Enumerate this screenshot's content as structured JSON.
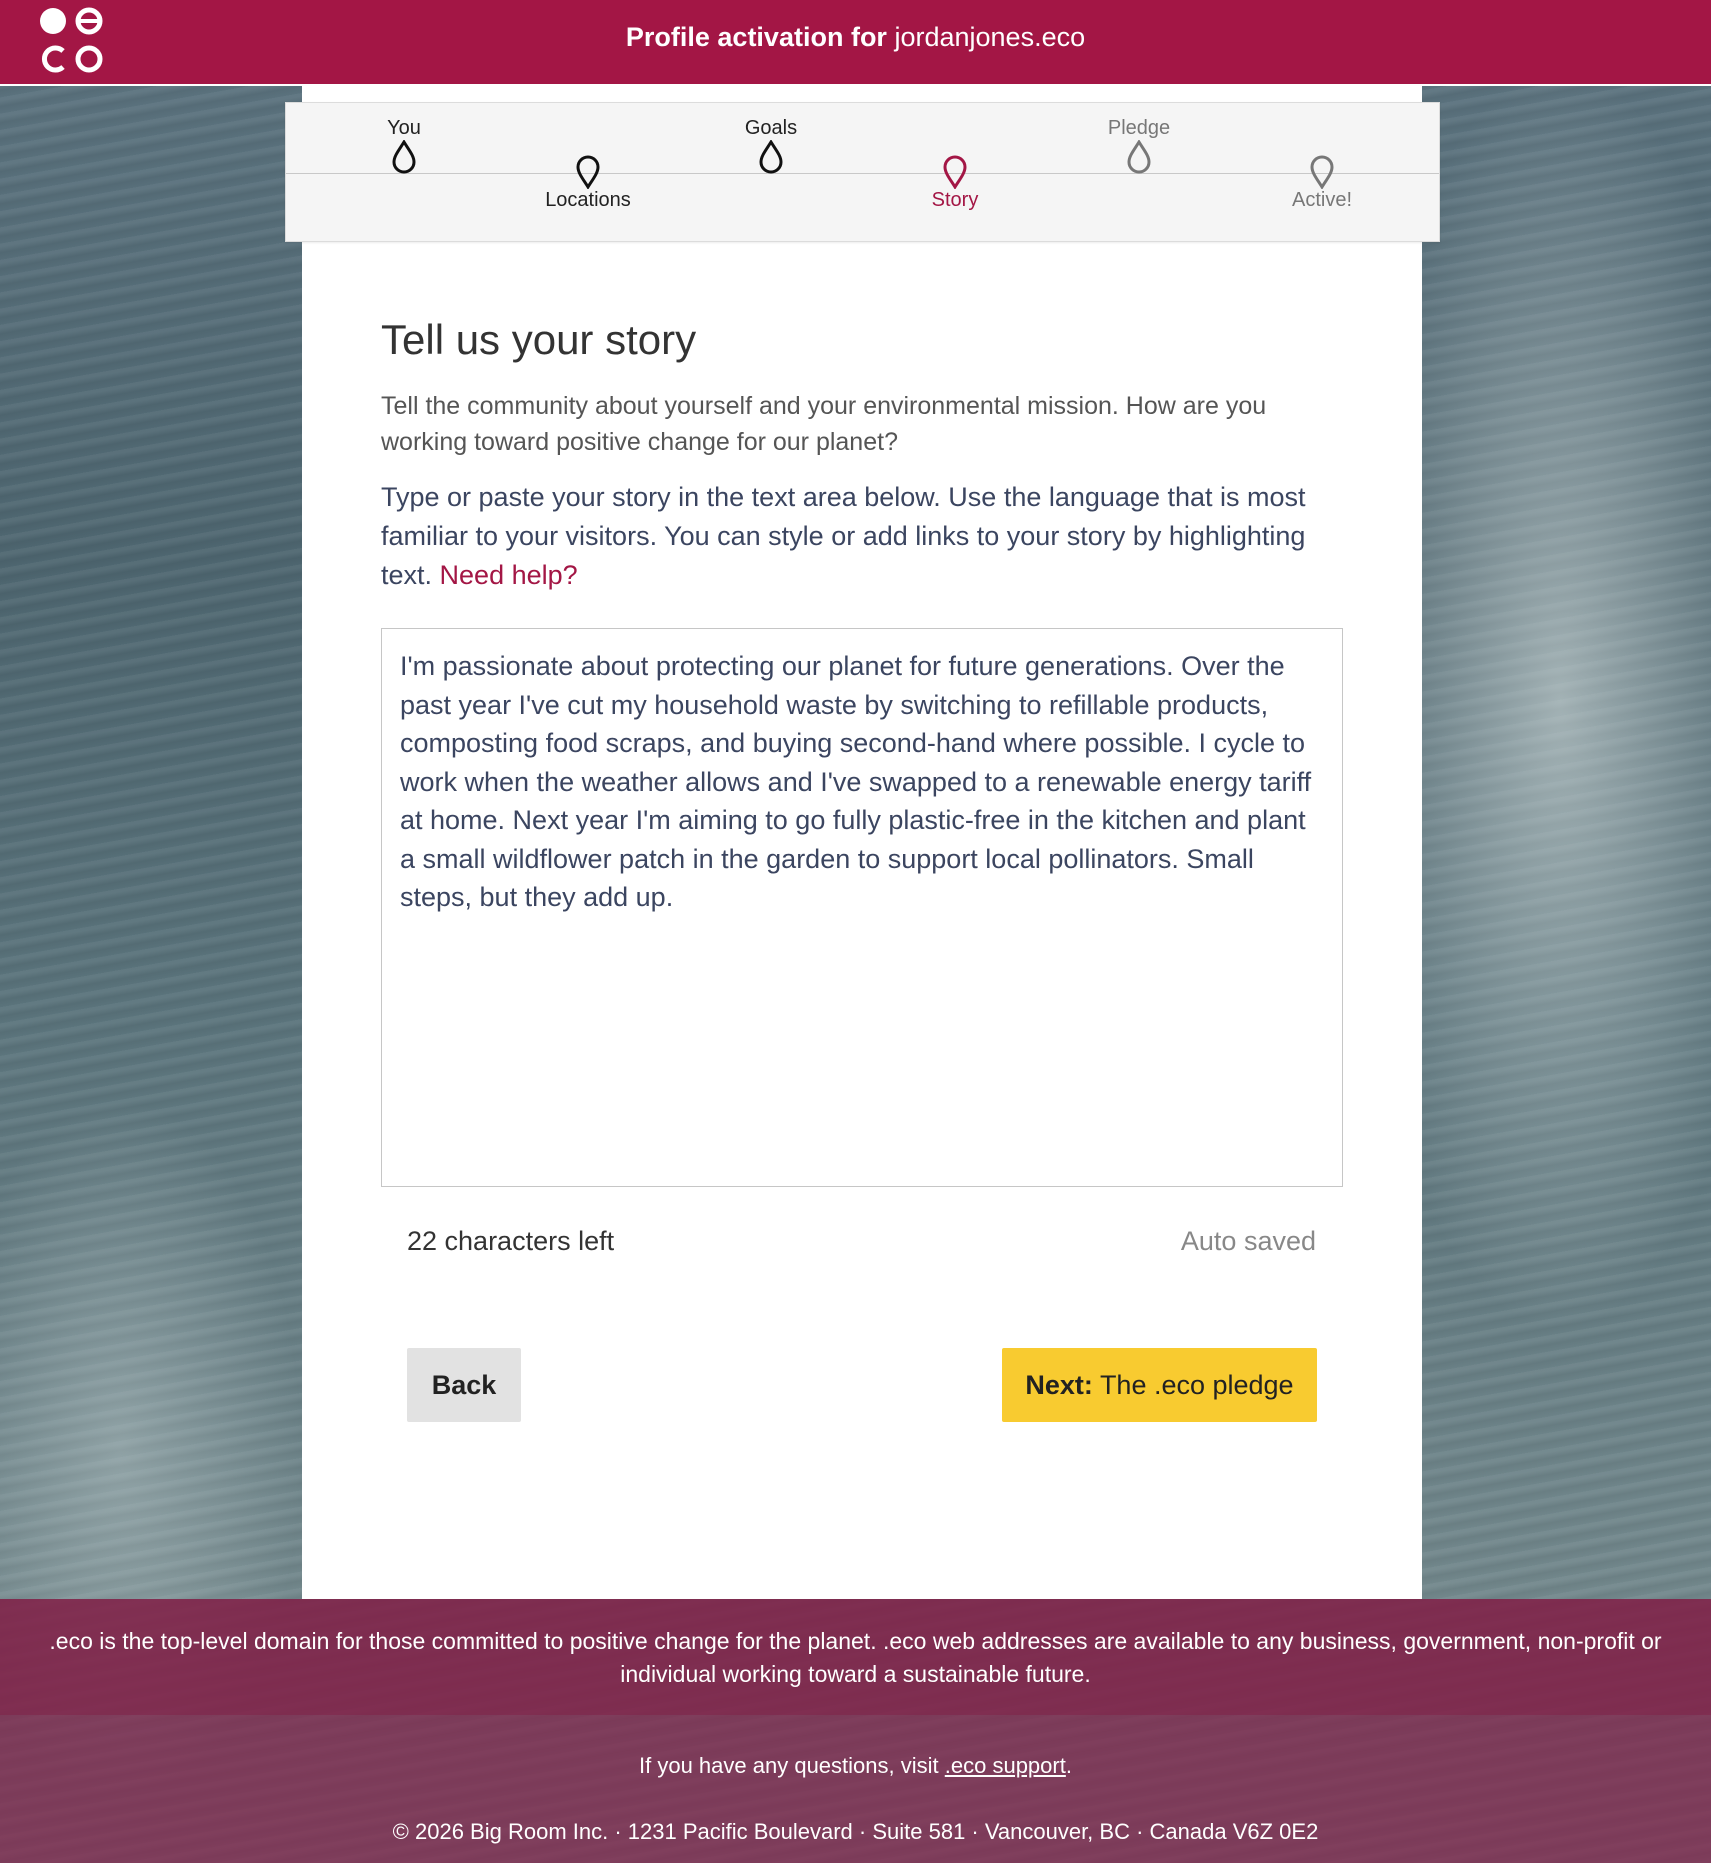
{
  "header": {
    "title_prefix": "Profile activation for",
    "domain": "jordanjones.eco"
  },
  "stepper": {
    "steps": [
      {
        "label": "You",
        "state": "complete"
      },
      {
        "label": "Locations",
        "state": "complete"
      },
      {
        "label": "Goals",
        "state": "complete"
      },
      {
        "label": "Story",
        "state": "current"
      },
      {
        "label": "Pledge",
        "state": "upcoming"
      },
      {
        "label": "Active!",
        "state": "upcoming"
      }
    ]
  },
  "main": {
    "heading": "Tell us your story",
    "intro": "Tell the community about yourself and your environmental mission. How are you working toward positive change for our planet?",
    "instructions": "Type or paste your story in the text area below. Use the language that is most familiar to your visitors. You can style or add links to your story by highlighting text.",
    "help_link": "Need help?",
    "story": "I'm passionate about protecting our planet for future generations. Over the past year I've cut my household waste by switching to refillable products, composting food scraps, and buying second-hand where possible. I cycle to work when the weather allows and I've swapped to a renewable energy tariff at home. Next year I'm aiming to go fully plastic-free in the kitchen and plant a small wildflower patch in the garden to support local pollinators. Small steps, but they add up.",
    "chars_left": "22 characters left",
    "autosave": "Auto saved",
    "back_label": "Back",
    "next_label_bold": "Next:",
    "next_label_rest": "The .eco pledge"
  },
  "footer": {
    "about": ".eco is the top-level domain for those committed to positive change for the planet. .eco web addresses are available to any business, government, non-profit or individual working toward a sustainable future.",
    "support_prefix": "If you have any questions, visit",
    "support_link": ".eco support",
    "support_suffix": ".",
    "copyright": "© 2026 Big Room Inc. · 1231 Pacific Boulevard · Suite 581 · Vancouver, BC · Canada V6Z 0E2"
  },
  "colors": {
    "brand": "#a31645",
    "accent_button": "#f8cb30",
    "step_complete": "#111111",
    "step_current": "#a31645",
    "step_upcoming": "#777777"
  },
  "icons": [
    "eco-logo",
    "drop-pin-icon"
  ]
}
